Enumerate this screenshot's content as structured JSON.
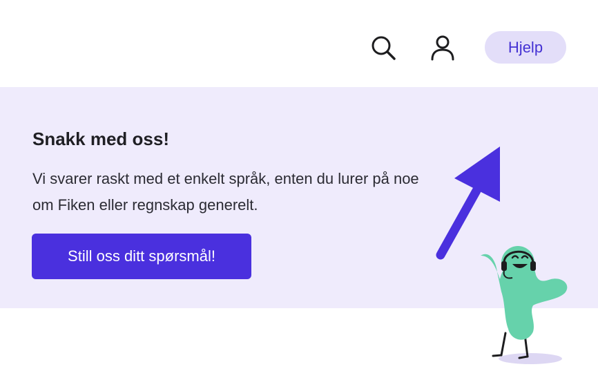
{
  "header": {
    "search_icon": "search-icon",
    "user_icon": "user-icon",
    "help_label": "Hjelp"
  },
  "panel": {
    "title": "Snakk med oss!",
    "text": "Vi svarer raskt med et enkelt språk, enten du lurer på noe om Fiken eller regnskap generelt.",
    "button_label": "Still oss ditt spørsmål!"
  },
  "colors": {
    "accent": "#4a30de",
    "help_bg": "#e3def9",
    "panel_bg": "#efebfc",
    "mascot": "#66d2ab"
  },
  "illustration": {
    "arrow_icon": "arrow-up-right-icon",
    "mascot_icon": "support-mascot-with-headset"
  }
}
